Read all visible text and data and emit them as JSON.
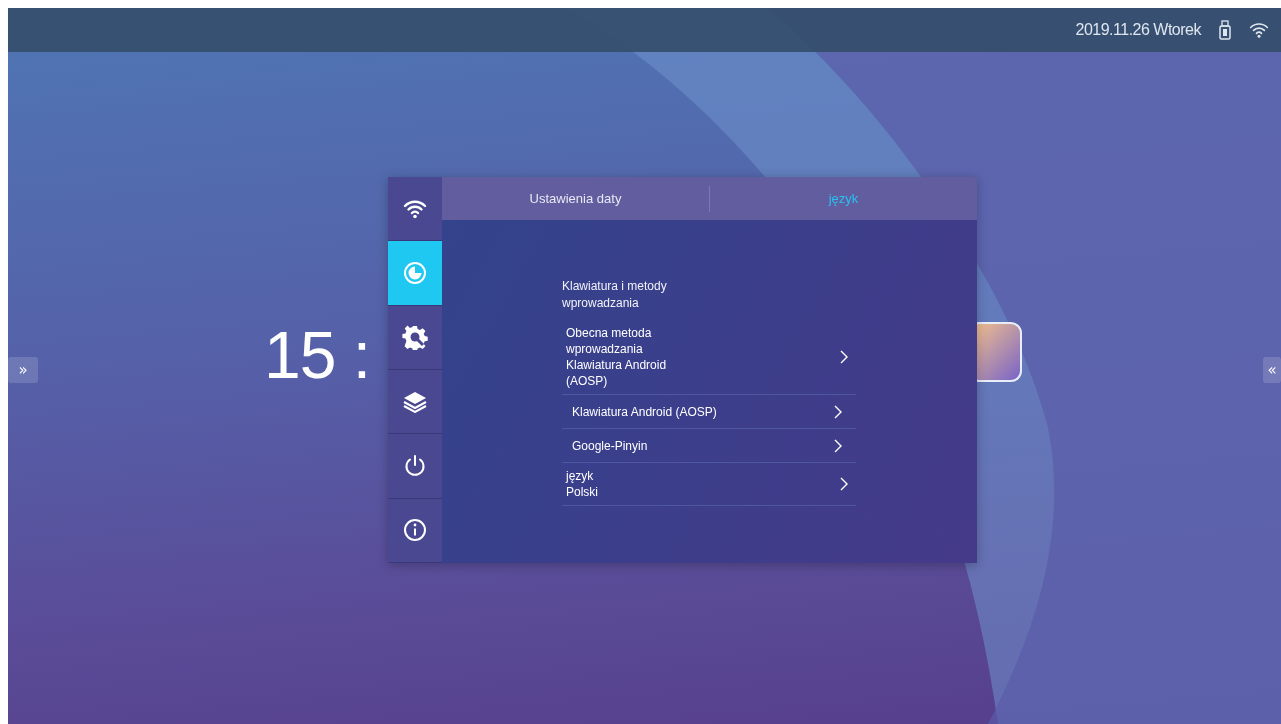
{
  "status_bar": {
    "date": "2019.11.26 Wtorek"
  },
  "clock": {
    "text": "15 :"
  },
  "side_handles": [
    {
      "glyph": "»"
    },
    {
      "glyph": "«"
    }
  ],
  "settings": {
    "sidebar": [
      {
        "selected": false
      },
      {
        "selected": true
      },
      {
        "selected": false
      },
      {
        "selected": false
      },
      {
        "selected": false
      },
      {
        "selected": false
      }
    ],
    "tabs": [
      {
        "label": "Ustawienia daty",
        "selected": false
      },
      {
        "label": "język",
        "selected": true
      }
    ],
    "heading": "Klawiatura i metody wprowadzania",
    "rows": [
      {
        "kind": "value",
        "title": "Obecna metoda wprowadzania",
        "value": "Klawiatura Android (AOSP)"
      },
      {
        "kind": "option",
        "title": "Klawiatura Android (AOSP)"
      },
      {
        "kind": "option",
        "title": "Google-Pinyin"
      },
      {
        "kind": "value",
        "title": "język",
        "value": "Polski"
      }
    ]
  }
}
